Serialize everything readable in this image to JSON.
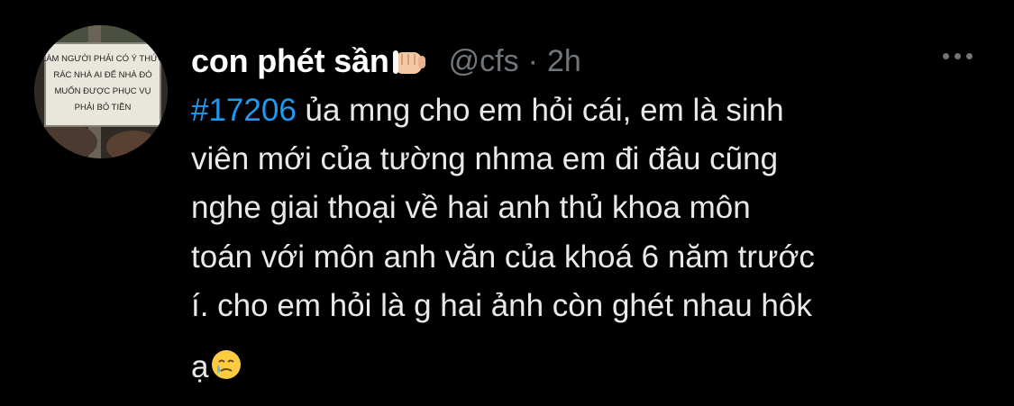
{
  "tweet": {
    "display_name": "con phét sần",
    "display_name_emoji": "fist-bump-emoji",
    "handle": "@cfs",
    "separator": "·",
    "time": "2h",
    "more_icon": "more-horizontal-icon",
    "hashtag": "#17206",
    "body_lines": [
      " ủa mng cho em hỏi cái, em là sinh",
      "viên mới của tường nhma em đi đâu cũng",
      "nghe giai thoại về hai anh thủ khoa môn",
      "toán với môn anh văn của khoá 6 năm trước",
      "í. cho em hỏi là g hai ảnh còn ghét nhau hôk"
    ],
    "last_line": "ạ",
    "last_line_emoji": "crying-face-emoji",
    "avatar_sign_lines": [
      "LÀM NGƯỜI PHẢI CÓ Ý THỨC",
      "RÁC NHÀ AI ĐỂ NHÀ ĐÓ",
      "MUỐN ĐƯỢC PHỤC VỤ",
      "PHẢI BỎ TIỀN"
    ]
  },
  "colors": {
    "background": "#000000",
    "text_primary": "#e7e9ea",
    "name": "#ffffff",
    "secondary": "#71767b",
    "hashtag": "#1d9bf0"
  }
}
